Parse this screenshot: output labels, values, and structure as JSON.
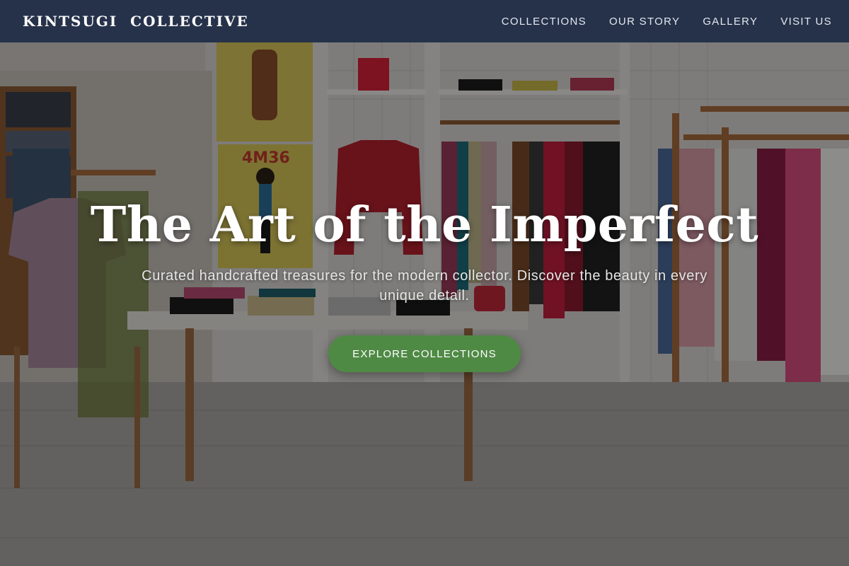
{
  "brand": {
    "name": "KINTSUGI  COLLECTIVE"
  },
  "nav": {
    "links": [
      "COLLECTIONS",
      "OUR STORY",
      "GALLERY",
      "VISIT US"
    ]
  },
  "hero": {
    "title": "The Art of the Imperfect",
    "subtitle": "Curated handcrafted treasures for the modern collector. Discover the beauty in every unique detail.",
    "cta_label": "EXPLORE COLLECTIONS",
    "poster_text": "4M36",
    "background_description_icon": "clothing-store-photo"
  },
  "colors": {
    "navbar": "#26324a",
    "cta": "#4f8a45",
    "title": "#ffffff"
  }
}
